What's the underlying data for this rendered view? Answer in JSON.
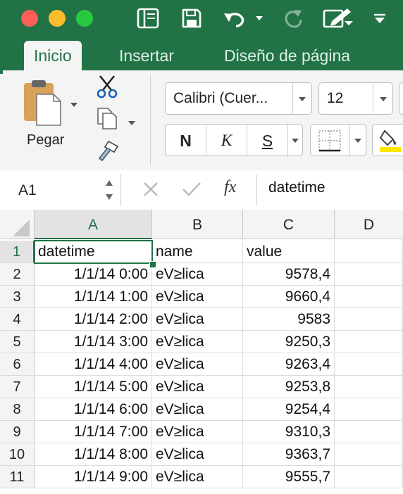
{
  "window": {
    "controls": [
      "close",
      "minimize",
      "zoom"
    ]
  },
  "quick_access": {
    "icons": [
      "sidebar-icon",
      "save-icon",
      "undo-icon",
      "undo-dropdown-icon",
      "redo-icon",
      "edit-icon",
      "customize-dropdown-icon"
    ]
  },
  "tabs": [
    {
      "label": "Inicio",
      "active": true
    },
    {
      "label": "Insertar",
      "active": false
    },
    {
      "label": "Diseño de página",
      "active": false
    }
  ],
  "ribbon": {
    "paste_label": "Pegar",
    "font_name": "Calibri (Cuer...",
    "font_size": "12",
    "bold_label": "N",
    "italic_label": "K",
    "underline_label": "S"
  },
  "formula_bar": {
    "name_box": "A1",
    "fx_label": "fx",
    "content": "datetime"
  },
  "sheet": {
    "columns": [
      "A",
      "B",
      "C",
      "D"
    ],
    "selected_cell": "A1",
    "rows": [
      {
        "num": "1",
        "a": "datetime",
        "b": "name",
        "c": "value",
        "d": ""
      },
      {
        "num": "2",
        "a": "1/1/14 0:00",
        "b": "eV≥lica",
        "c": "9578,4",
        "d": ""
      },
      {
        "num": "3",
        "a": "1/1/14 1:00",
        "b": "eV≥lica",
        "c": "9660,4",
        "d": ""
      },
      {
        "num": "4",
        "a": "1/1/14 2:00",
        "b": "eV≥lica",
        "c": "9583",
        "d": ""
      },
      {
        "num": "5",
        "a": "1/1/14 3:00",
        "b": "eV≥lica",
        "c": "9250,3",
        "d": ""
      },
      {
        "num": "6",
        "a": "1/1/14 4:00",
        "b": "eV≥lica",
        "c": "9263,4",
        "d": ""
      },
      {
        "num": "7",
        "a": "1/1/14 5:00",
        "b": "eV≥lica",
        "c": "9253,8",
        "d": ""
      },
      {
        "num": "8",
        "a": "1/1/14 6:00",
        "b": "eV≥lica",
        "c": "9254,4",
        "d": ""
      },
      {
        "num": "9",
        "a": "1/1/14 7:00",
        "b": "eV≥lica",
        "c": "9310,3",
        "d": ""
      },
      {
        "num": "10",
        "a": "1/1/14 8:00",
        "b": "eV≥lica",
        "c": "9363,7",
        "d": ""
      },
      {
        "num": "11",
        "a": "1/1/14 9:00",
        "b": "eV≥lica",
        "c": "9555,7",
        "d": ""
      }
    ]
  },
  "colors": {
    "brand_green": "#217346",
    "close": "#fc5f57",
    "minimize": "#fdbc2e",
    "zoom": "#28c840",
    "selection_border": "#217346"
  }
}
